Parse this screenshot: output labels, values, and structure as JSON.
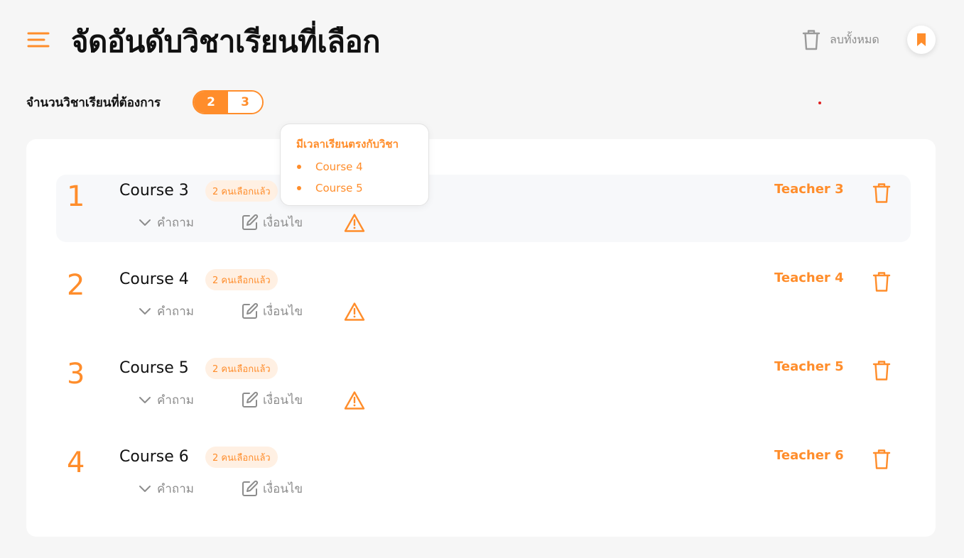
{
  "header": {
    "title": "จัดอันดับวิชาเรียนที่เลือก",
    "clear_all_label": "ลบทั้งหมด"
  },
  "count_selector": {
    "label": "จำนวนวิชาเรียนที่ต้องการ",
    "options": [
      "2",
      "3"
    ],
    "selected": "2"
  },
  "tooltip": {
    "title": "มีเวลาเรียนตรงกับวิชา",
    "items": [
      "Course 4",
      "Course 5"
    ]
  },
  "courses": [
    {
      "rank": "1",
      "name": "Course 3",
      "badge": "2 คนเลือกแล้ว",
      "teacher": "Teacher 3",
      "questions_label": "คำถาม",
      "condition_label": "เงื่อนไข",
      "has_warning": true
    },
    {
      "rank": "2",
      "name": "Course 4",
      "badge": "2 คนเลือกแล้ว",
      "teacher": "Teacher 4",
      "questions_label": "คำถาม",
      "condition_label": "เงื่อนไข",
      "has_warning": true
    },
    {
      "rank": "3",
      "name": "Course 5",
      "badge": "2 คนเลือกแล้ว",
      "teacher": "Teacher 5",
      "questions_label": "คำถาม",
      "condition_label": "เงื่อนไข",
      "has_warning": true
    },
    {
      "rank": "4",
      "name": "Course 6",
      "badge": "2 คนเลือกแล้ว",
      "teacher": "Teacher 6",
      "questions_label": "คำถาม",
      "condition_label": "เงื่อนไข",
      "has_warning": false
    }
  ],
  "colors": {
    "accent": "#ff8d2b",
    "badge_bg": "#fff0e3",
    "muted": "#8c8c8c",
    "page_bg": "#f6f6f6"
  },
  "icons": [
    "menu-icon",
    "trash-icon",
    "bookmark-icon",
    "chevron-down-icon",
    "edit-icon",
    "warning-icon"
  ]
}
